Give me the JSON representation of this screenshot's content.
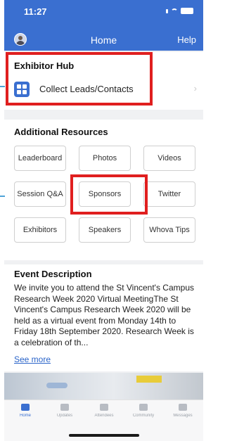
{
  "status_bar": {
    "time": "11:27"
  },
  "nav": {
    "title": "Home",
    "help": "Help"
  },
  "exhibitor_hub": {
    "title": "Exhibitor Hub",
    "item_label": "Collect Leads/Contacts"
  },
  "resources": {
    "title": "Additional Resources",
    "buttons": [
      "Leaderboard",
      "Photos",
      "Videos",
      "Session Q&A",
      "Sponsors",
      "Twitter",
      "Exhibitors",
      "Speakers",
      "Whova Tips"
    ]
  },
  "event": {
    "title": "Event Description",
    "description": "We invite you to attend the St Vincent's Campus Research Week 2020 Virtual MeetingThe St Vincent's Campus Research Week 2020 will be held as a virtual event from Monday 14th to Friday 18th September 2020. Research Week is a celebration of th...",
    "see_more": "See more"
  },
  "tabbar": {
    "tabs": [
      "Home",
      "Updates",
      "Attendees",
      "Community",
      "Messages"
    ]
  },
  "colors": {
    "header": "#3a6fd0",
    "highlight": "#e01f1f",
    "link": "#2a64c9"
  }
}
